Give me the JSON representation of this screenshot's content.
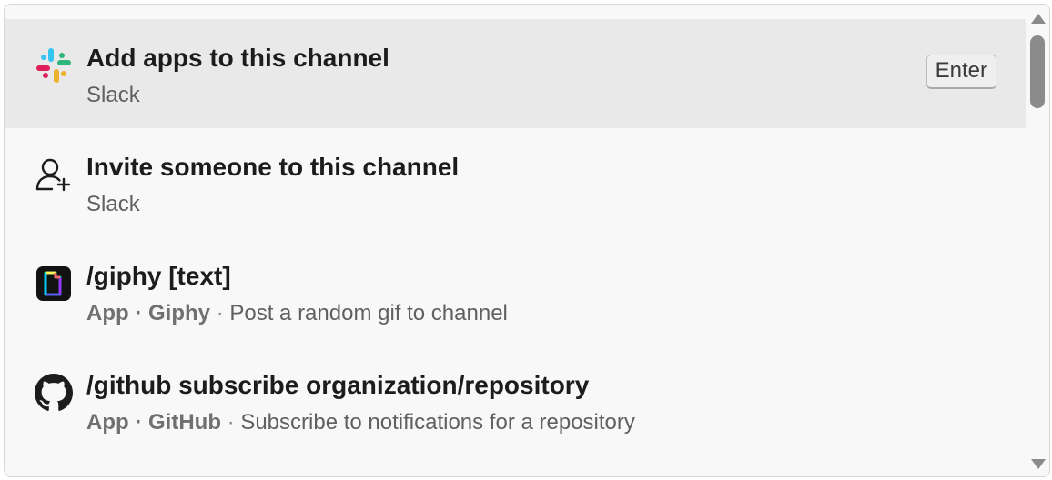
{
  "items": [
    {
      "title": "Add apps to this channel",
      "subtitle": "Slack",
      "icon": "slack-logo-icon",
      "shortcut": "Enter",
      "selected": true
    },
    {
      "title": "Invite someone to this channel",
      "subtitle": "Slack",
      "icon": "add-person-icon",
      "selected": false
    },
    {
      "title": "/giphy [text]",
      "type_label": "App",
      "app_name": "Giphy",
      "separator": "·",
      "description": "Post a random gif to channel",
      "icon": "giphy-logo-icon",
      "selected": false
    },
    {
      "title": "/github subscribe organization/repository",
      "type_label": "App",
      "app_name": "GitHub",
      "separator": "·",
      "description": "Subscribe to notifications for a repository",
      "icon": "github-logo-icon",
      "selected": false
    }
  ],
  "colors": {
    "selected_background": "#e9e9e9",
    "panel_background": "#f8f8f8",
    "title_text": "#1d1c1d",
    "subtitle_text": "#616061"
  }
}
